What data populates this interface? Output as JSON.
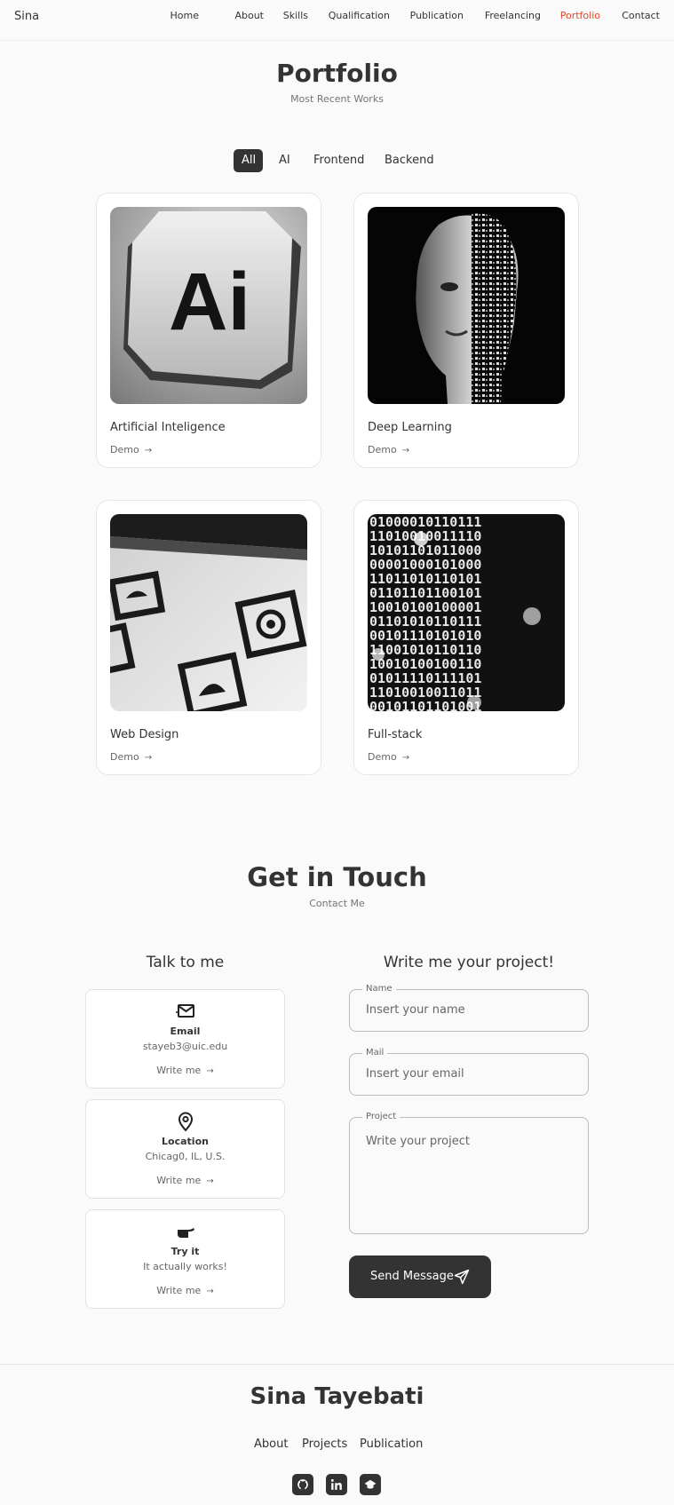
{
  "header": {
    "logo": "Sina",
    "nav": [
      "Home",
      "About",
      "Skills",
      "Qualification",
      "Publication",
      "Freelancing",
      "Portfolio",
      "Contact"
    ],
    "active_nav": "Portfolio",
    "accent_color": "#e0482a"
  },
  "portfolio": {
    "title": "Portfolio",
    "subtitle": "Most Recent Works",
    "filters": [
      "All",
      "AI",
      "Frontend",
      "Backend"
    ],
    "active_filter": "All",
    "projects": [
      {
        "title": "Artificial Inteligence",
        "link": "Demo",
        "icon": "ai-logo-image"
      },
      {
        "title": "Deep Learning",
        "link": "Demo",
        "icon": "digital-head-image"
      },
      {
        "title": "Web Design",
        "link": "Demo",
        "icon": "web-icons-image"
      },
      {
        "title": "Full-stack",
        "link": "Demo",
        "icon": "binary-code-image"
      }
    ]
  },
  "contact": {
    "title": "Get in Touch",
    "subtitle": "Contact Me",
    "left_title": "Talk to me",
    "right_title": "Write me your project!",
    "cards": [
      {
        "label": "Email",
        "value": "stayeb3@uic.edu",
        "action": "Write me",
        "icon": "mail-icon"
      },
      {
        "label": "Location",
        "value": "Chicag0, IL, U.S.",
        "action": "Write me",
        "icon": "map-pin-icon"
      },
      {
        "label": "Try it",
        "value": "It actually works!",
        "action": "Write me",
        "icon": "pointing-hand-icon"
      }
    ],
    "form": {
      "name_label": "Name",
      "name_placeholder": "Insert your name",
      "mail_label": "Mail",
      "mail_placeholder": "Insert your email",
      "project_label": "Project",
      "project_placeholder": "Write your project",
      "send_label": "Send Message"
    }
  },
  "footer": {
    "title": "Sina Tayebati",
    "links": [
      "About",
      "Projects",
      "Publication"
    ],
    "social": [
      "github-icon",
      "linkedin-icon",
      "scholar-icon"
    ]
  }
}
